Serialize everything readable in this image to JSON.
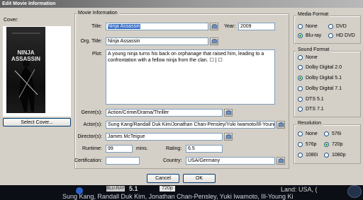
{
  "window": {
    "title": "Edit Movie Information"
  },
  "cover": {
    "label": "Cover:",
    "poster_title_line1": "NINJA",
    "poster_title_line2": "ASSASSIN",
    "select_button": "Select Cover..."
  },
  "movie_info": {
    "group_title": "Movie Information",
    "title_label": "Title:",
    "title_value": "Ninja Assassin",
    "year_label": "Year:",
    "year_value": "2009",
    "org_title_label": "Org. Title:",
    "org_title_value": "Ninja Assassin",
    "plot_label": "Plot:",
    "plot_value": "A young ninja turns his back on orphanage that raised him, leading to a confrontation with a fellow ninja from the clan. ☐ | ☐",
    "genres_label": "Genre(s):",
    "genres_value": "Action/Crime/Drama/Thriller",
    "actors_label": "Actor(s):",
    "actors_value": "Sung Kang/Randall Duk Kim/Jonathan Chan-Pensley/Yuki Iwamoto/Ill-Young Ki",
    "directors_label": "Director(s):",
    "directors_value": "James McTeigue",
    "runtime_label": "Runtime:",
    "runtime_value": "99",
    "runtime_unit": "mins.",
    "rating_label": "Rating:",
    "rating_value": "6.5",
    "certification_label": "Certification:",
    "certification_value": "",
    "country_label": "Country:",
    "country_value": "USA/Germany"
  },
  "media_format": {
    "group_title": "Media Format",
    "options": [
      "None",
      "DVD",
      "Blu-ray",
      "HD DVD"
    ],
    "selected": "Blu-ray"
  },
  "sound_format": {
    "group_title": "Sound Format",
    "options": [
      "None",
      "Dolby Digital 2.0",
      "Dolby Digital 5.1",
      "Dolby Digital 7.1",
      "DTS 5.1",
      "DTS 7.1"
    ],
    "selected": "Dolby Digital 5.1"
  },
  "resolution": {
    "group_title": "Resolution",
    "options": [
      "None",
      "576i",
      "576p",
      "720p",
      "1080i",
      "1080p"
    ],
    "selected": "720p"
  },
  "buttons": {
    "cancel": "Cancel",
    "ok": "OK"
  },
  "background": {
    "audio_badge": "5.1",
    "resolution_badge": "720p",
    "disc_logo": "BLU-RAY",
    "land_text": "Land: USA, (",
    "cast_text": "Sung Kang, Randall Duk Kim, Jonathan Chan-Pensley, Yuki Iwamoto, Ill-Young Ki"
  },
  "colors": {
    "window_bg": "#d4d0c8",
    "selection": "#316ac5",
    "radio_dot": "#21a121"
  }
}
